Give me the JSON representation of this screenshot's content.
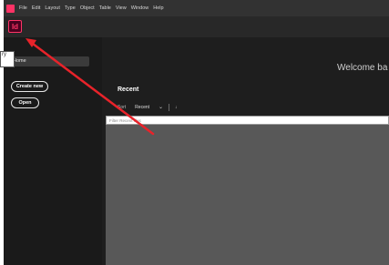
{
  "menubar": {
    "items": [
      "File",
      "Edit",
      "Layout",
      "Type",
      "Object",
      "Table",
      "View",
      "Window",
      "Help"
    ]
  },
  "app": {
    "logo_text": "Id",
    "brand_color": "#ff3366"
  },
  "sidebar": {
    "home_label": "Home",
    "create_new_label": "Create new",
    "open_label": "Open"
  },
  "main": {
    "welcome_text": "Welcome ba",
    "recent_heading": "Recent",
    "sort_label": "Sort",
    "sort_value": "Recent",
    "sort_direction": "↓",
    "filter_placeholder": "Filter Recent files"
  },
  "annotation": {
    "snippet_text": "ry",
    "arrow_color": "#e8232a"
  }
}
